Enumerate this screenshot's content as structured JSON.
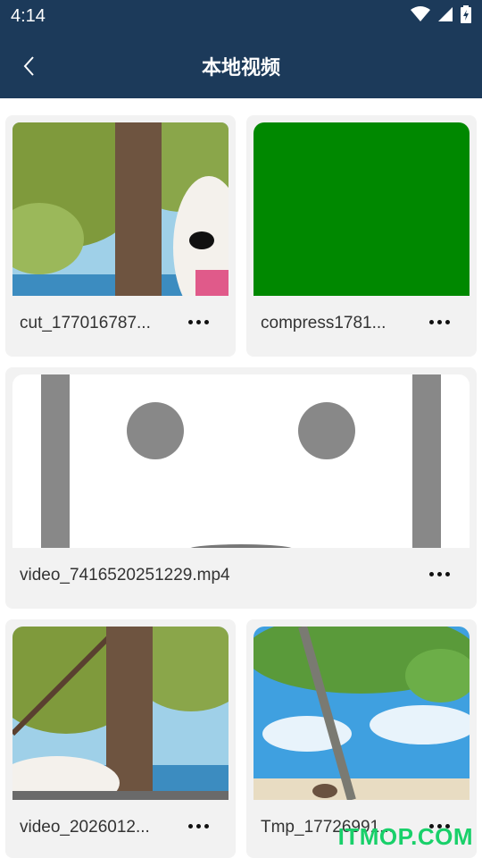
{
  "status_bar": {
    "time": "4:14"
  },
  "header": {
    "title": "本地视频"
  },
  "videos": [
    {
      "name": "cut_177016787..."
    },
    {
      "name": "compress1781..."
    },
    {
      "name": "video_7416520251229.mp4"
    },
    {
      "name": "video_2026012..."
    },
    {
      "name": "Tmp_17726991..."
    }
  ],
  "watermark": "ITMOP.COM",
  "colors": {
    "header_bg": "#1c3a5a",
    "card_bg": "#f2f2f2",
    "green_thumb": "#008800"
  }
}
